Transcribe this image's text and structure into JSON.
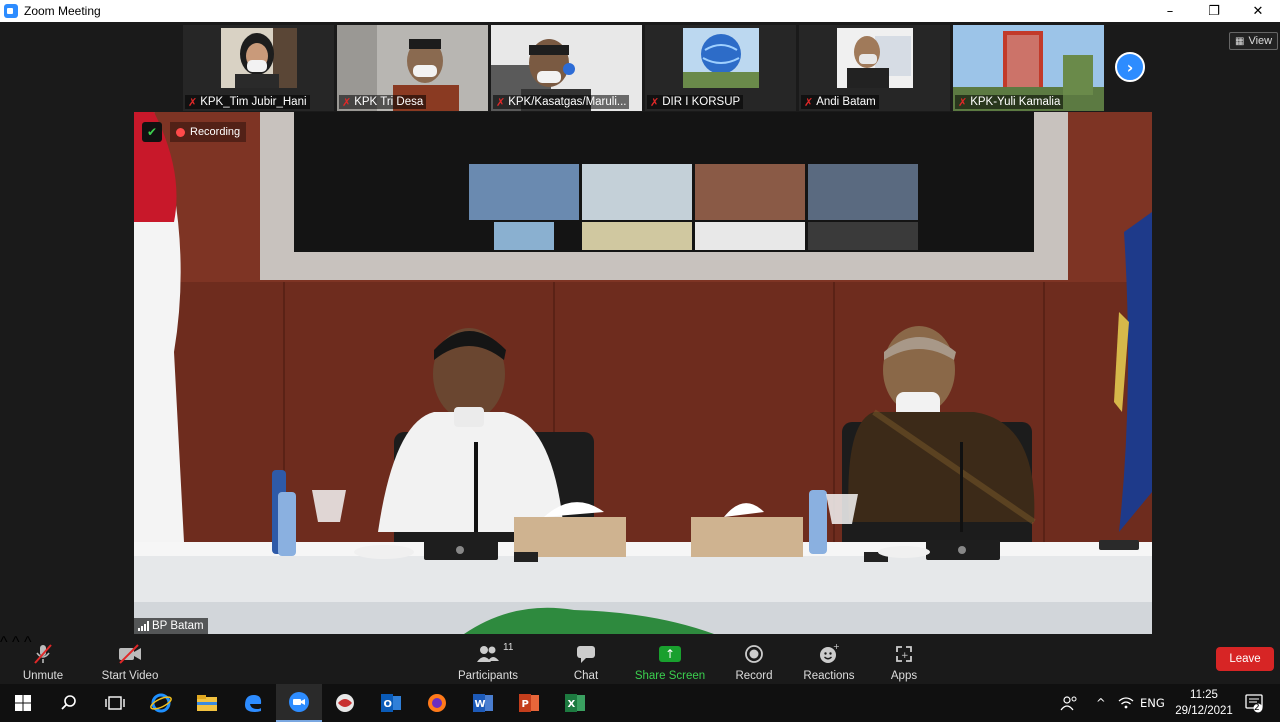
{
  "window": {
    "title": "Zoom Meeting",
    "controls": [
      "minimize",
      "restore",
      "close"
    ]
  },
  "gallery": {
    "tiles": [
      {
        "name": "KPK_Tim Jubir_Hani",
        "muted": true
      },
      {
        "name": "KPK Tri Desa",
        "muted": true
      },
      {
        "name": "KPK/Kasatgas/Maruli...",
        "muted": true
      },
      {
        "name": "DIR I KORSUP",
        "muted": true
      },
      {
        "name": "Andi Batam",
        "muted": true
      },
      {
        "name": "KPK-Yuli Kamalia",
        "muted": true
      }
    ],
    "view_label": "View"
  },
  "main_video": {
    "recording_label": "Recording",
    "speaker_name": "BP Batam"
  },
  "toolbar": {
    "unmute": "Unmute",
    "start_video": "Start Video",
    "participants": "Participants",
    "participants_count": "11",
    "chat": "Chat",
    "share_screen": "Share Screen",
    "record": "Record",
    "reactions": "Reactions",
    "apps": "Apps",
    "leave": "Leave"
  },
  "taskbar": {
    "language": "ENG",
    "time": "11:25",
    "date": "29/12/2021",
    "notifications": "2"
  },
  "colors": {
    "zoom_blue": "#2d8cff",
    "share_green": "#19a02e",
    "leave_red": "#d72525",
    "muted_red": "#e02828"
  }
}
